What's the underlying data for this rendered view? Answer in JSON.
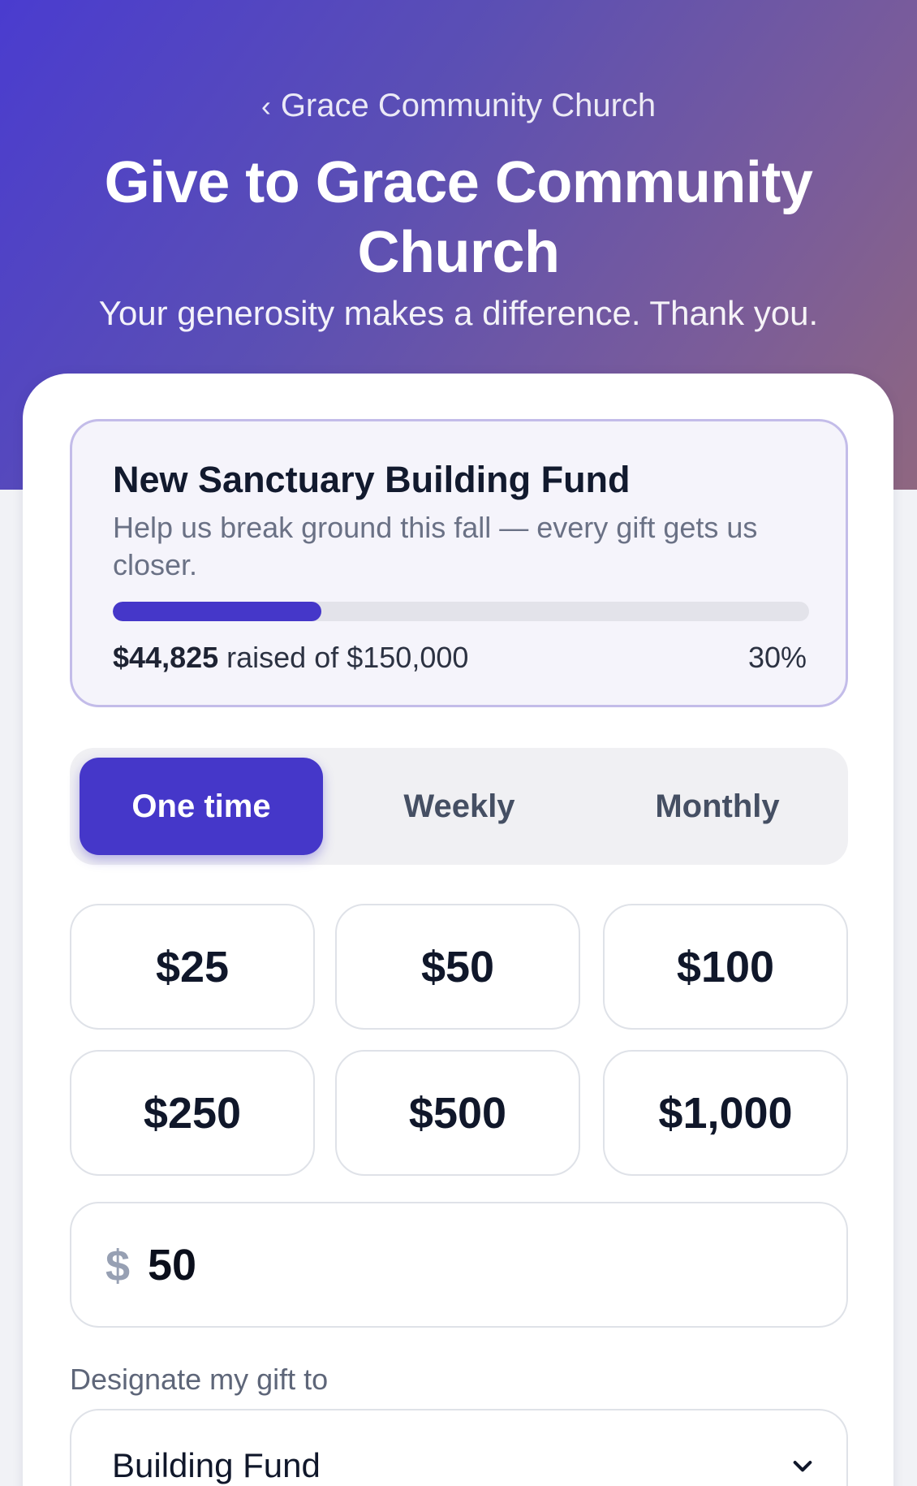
{
  "header": {
    "back_label": "Grace Community Church",
    "title": "Give to Grace Community Church",
    "subtitle": "Your generosity makes a difference. Thank you."
  },
  "campaign": {
    "title": "New Sanctuary Building Fund",
    "description": "Help us break ground this fall — every gift gets us closer.",
    "raised_amount": "$44,825",
    "raised_suffix": "raised of $150,000",
    "percent_label": "30%",
    "progress_percent": 30
  },
  "frequency": {
    "selected": "One time",
    "options": [
      "One time",
      "Weekly",
      "Monthly"
    ]
  },
  "amounts": [
    "$25",
    "$50",
    "$100",
    "$250",
    "$500",
    "$1,000"
  ],
  "custom_amount": {
    "currency_symbol": "$",
    "value": "50"
  },
  "designation": {
    "label": "Designate my gift to",
    "selected": "Building Fund"
  },
  "colors": {
    "accent": "#4537c9",
    "hero_start": "#4a3ccf",
    "hero_end": "#8f6780"
  }
}
